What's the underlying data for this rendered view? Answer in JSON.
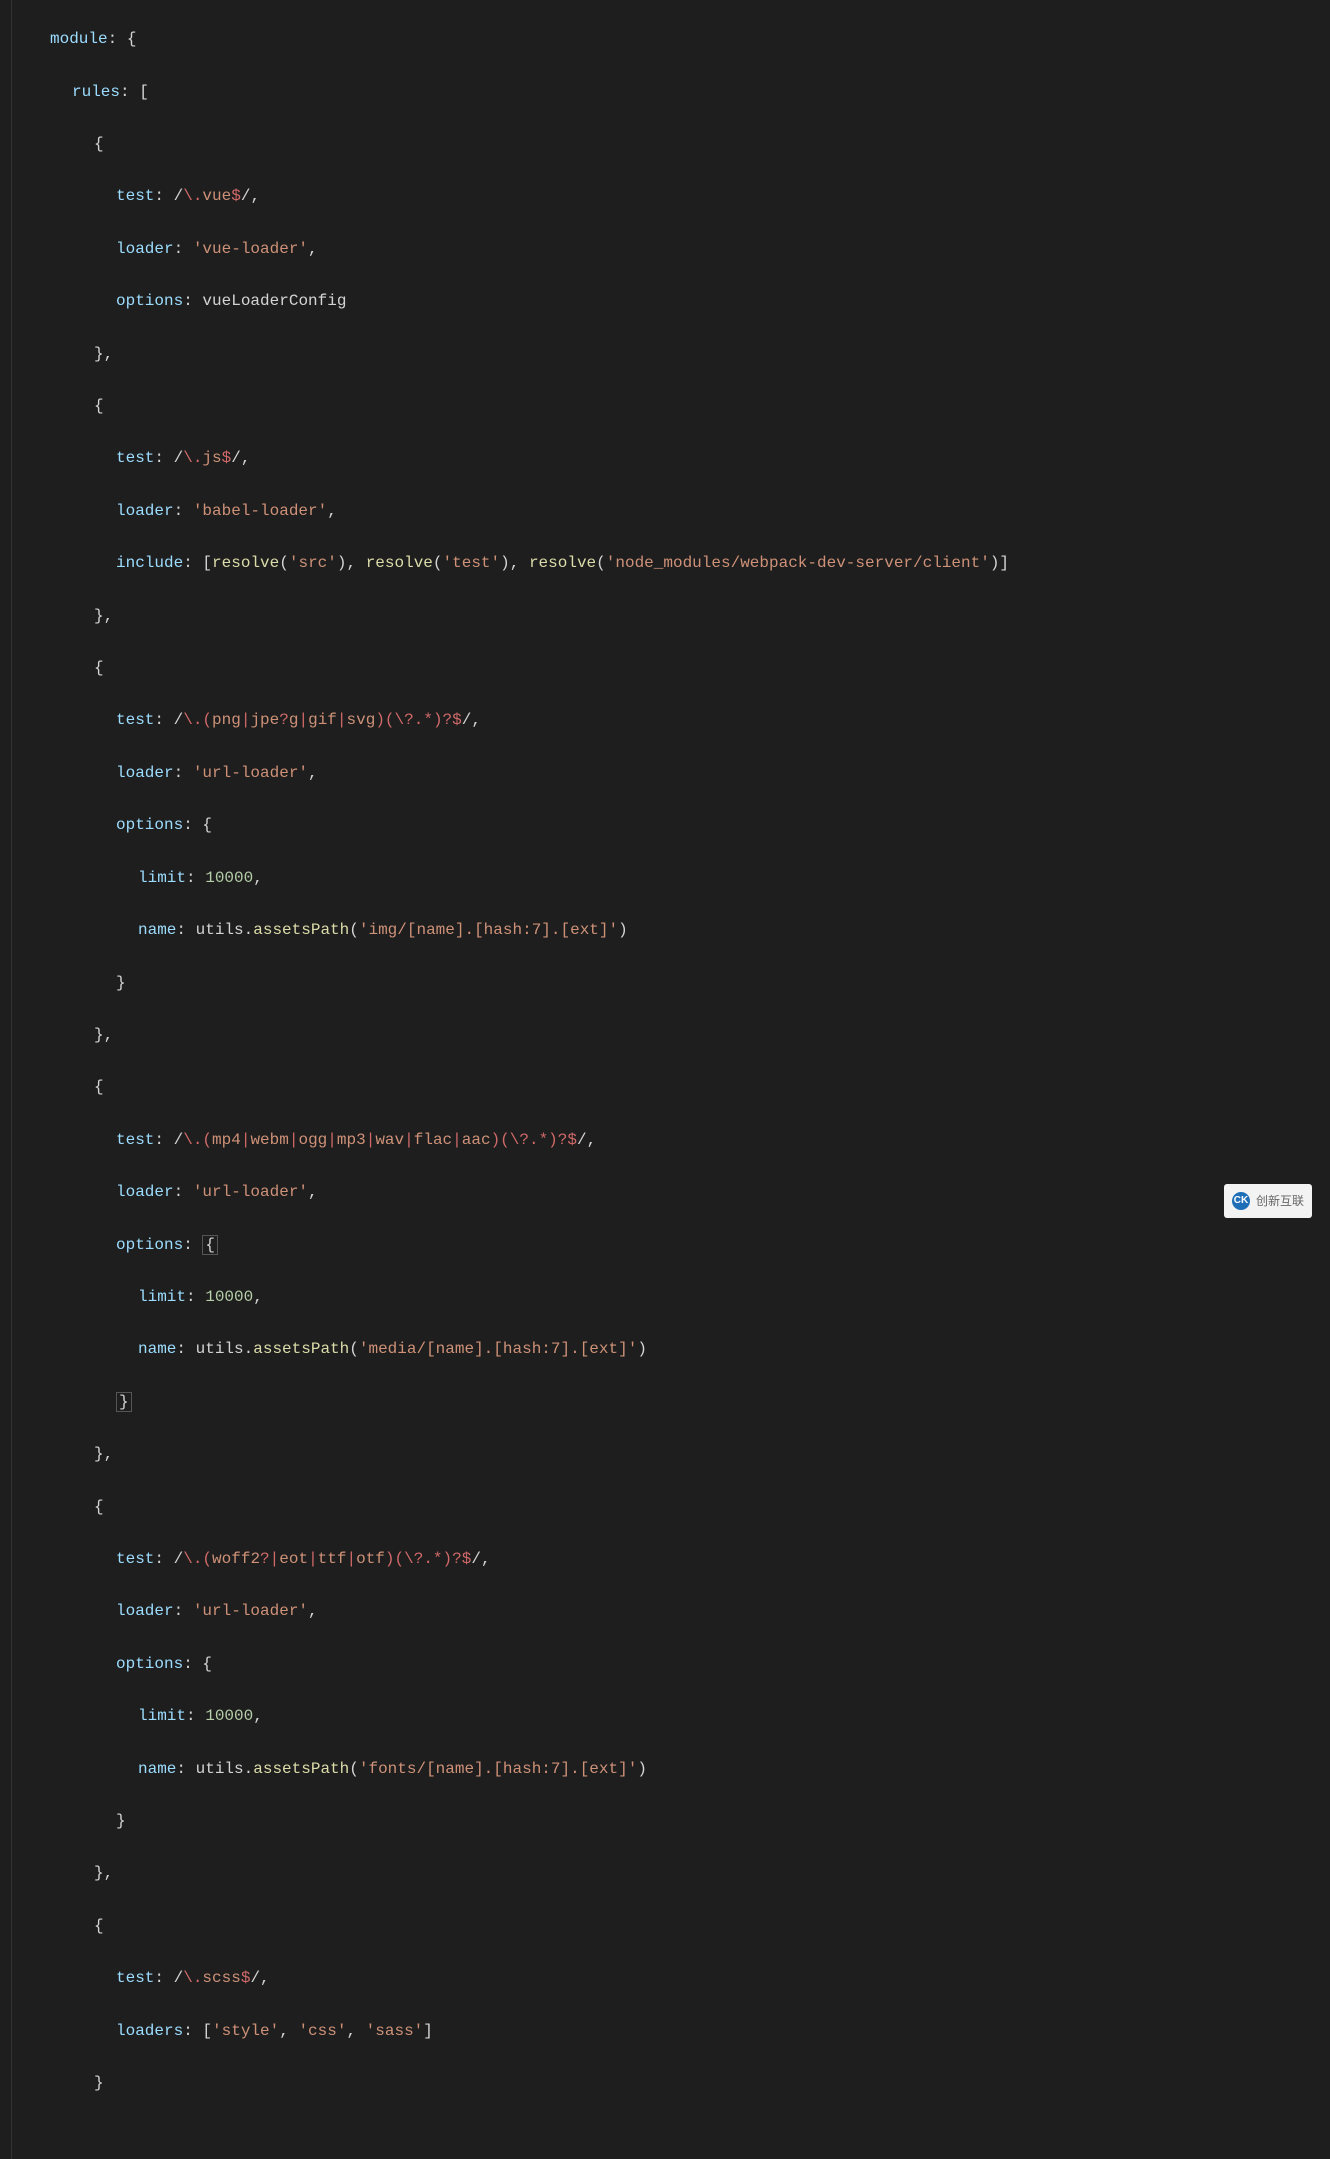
{
  "code": {
    "l1_module": "module",
    "l2_rules": "rules",
    "l4_test": "test",
    "l4_regex": "/\\.vue$/",
    "l5_loader": "loader",
    "l5_val": "'vue-loader'",
    "l6_options": "options",
    "l6_val": "vueLoaderConfig",
    "l9_test": "test",
    "l9_regex": "/\\.js$/",
    "l10_loader": "loader",
    "l10_val": "'babel-loader'",
    "l11_include": "include",
    "l11_resolve": "resolve",
    "l11_src": "'src'",
    "l11_test": "'test'",
    "l11_node": "'node_modules/webpack-dev-server/client'",
    "l14_test": "test",
    "l14_regex_open": "/\\.(",
    "l14_png": "png",
    "l14_jpe": "jpe",
    "l14_g": "g",
    "l14_gif": "gif",
    "l14_svg": "svg",
    "l14_regex_close": ")(\\?.*)?$/",
    "l15_loader": "loader",
    "l15_val": "'url-loader'",
    "l16_options": "options",
    "l17_limit": "limit",
    "l17_val": "10000",
    "l18_name": "name",
    "l18_utils": "utils",
    "l18_assetsPath": "assetsPath",
    "l18_val": "'img/[name].[hash:7].[ext]'",
    "l22_test": "test",
    "l22_regex_open": "/\\.(",
    "l22_mp4": "mp4",
    "l22_webm": "webm",
    "l22_ogg": "ogg",
    "l22_mp3": "mp3",
    "l22_wav": "wav",
    "l22_flac": "flac",
    "l22_aac": "aac",
    "l22_regex_close": ")(\\?.*)?$/",
    "l23_loader": "loader",
    "l23_val": "'url-loader'",
    "l24_options": "options",
    "l25_limit": "limit",
    "l25_val": "10000",
    "l26_name": "name",
    "l26_utils": "utils",
    "l26_assetsPath": "assetsPath",
    "l26_val": "'media/[name].[hash:7].[ext]'",
    "l30_test": "test",
    "l30_regex_open": "/\\.(",
    "l30_woff2": "woff2",
    "l30_eot": "eot",
    "l30_ttf": "ttf",
    "l30_otf": "otf",
    "l30_regex_close": ")(\\?.*)?$/",
    "l31_loader": "loader",
    "l31_val": "'url-loader'",
    "l32_options": "options",
    "l33_limit": "limit",
    "l33_val": "10000",
    "l34_name": "name",
    "l34_utils": "utils",
    "l34_assetsPath": "assetsPath",
    "l34_val": "'fonts/[name].[hash:7].[ext]'",
    "l38_test": "test",
    "l38_regex": "/\\.scss$/",
    "l39_loaders": "loaders",
    "l39_style": "'style'",
    "l39_css": "'css'",
    "l39_sass": "'sass'"
  },
  "watermark": {
    "icon": "CK",
    "text": "创新互联"
  }
}
